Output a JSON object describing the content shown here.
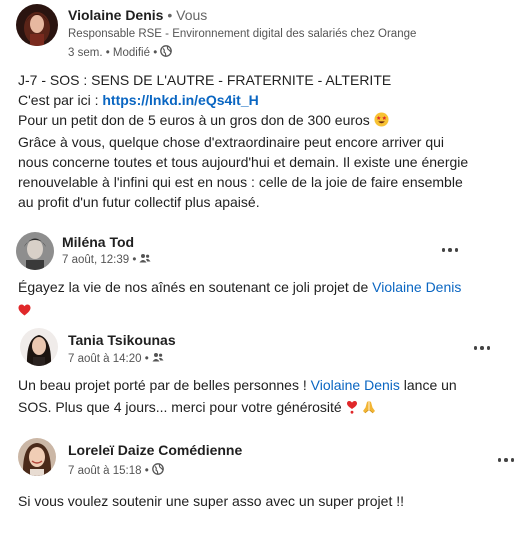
{
  "post": {
    "author": {
      "name": "Violaine Denis",
      "relation": " • Vous",
      "headline": "Responsable RSE - Environnement digital des salariés chez Orange",
      "time": "3 sem. • Modifié • "
    },
    "body": {
      "line1": "J-7 - SOS : SENS DE L'AUTRE - FRATERNITE - ALTERITE",
      "line2_prefix": "C'est par ici : ",
      "line2_link": "https://lnkd.in/eQs4it_H",
      "line3": "Pour un petit don de 5 euros à un gros don de 300 euros",
      "line4": "Grâce à vous, quelque chose d'extraordinaire peut encore arriver qui",
      "line5": "nous concerne toutes et tous aujourd'hui et demain. Il existe une énergie",
      "line6": "renouvelable à l'infini qui est en nous : celle de la joie de faire ensemble",
      "line7": "au profit d'un futur collectif plus apaisé."
    }
  },
  "comments": [
    {
      "name": "Miléna Tod",
      "time": "7 août, 12:39 • ",
      "visibility_icon": "people-icon",
      "text_prefix": "Égayez la vie de nos aînés en soutenant ce joli projet de ",
      "mention": "Violaine Denis"
    },
    {
      "name": "Tania Tsikounas",
      "time": "7 août à 14:20 • ",
      "visibility_icon": "people-icon",
      "text_prefix": "Un beau projet porté par de belles personnes ! ",
      "mention": "Violaine Denis",
      "text_suffix": " lance un",
      "text_line2": "SOS. Plus que 4 jours... merci pour votre générosité "
    },
    {
      "name": "Loreleï Daize Comédienne",
      "time": "7 août à 15:18 • ",
      "visibility_icon": "globe-icon",
      "text": "Si vous voulez soutenir une super asso avec un super projet !!"
    }
  ],
  "colors": {
    "link": "#0a66c2",
    "text": "#1f1f1f",
    "meta": "#555555"
  }
}
